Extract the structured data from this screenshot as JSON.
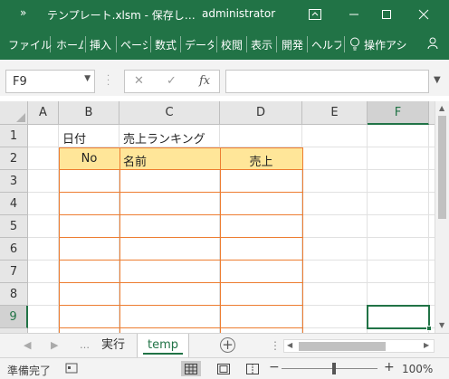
{
  "titlebar": {
    "title": "テンプレート.xlsm - 保存し…",
    "user": "administrator"
  },
  "ribbon": {
    "tabs": [
      "ファイル",
      "ホーム",
      "挿入",
      "ページ",
      "数式",
      "データ",
      "校閲",
      "表示",
      "開発",
      "ヘルプ",
      "操作アシ"
    ]
  },
  "formula_bar": {
    "name_box": "F9",
    "fx_label": "fx",
    "formula": ""
  },
  "grid": {
    "columns": [
      "A",
      "B",
      "C",
      "D",
      "E",
      "F"
    ],
    "selected_column": "F",
    "rows": [
      "1",
      "2",
      "3",
      "4",
      "5",
      "6",
      "7",
      "8",
      "9"
    ],
    "selected_row": "9",
    "cells": {
      "B1": "日付",
      "C1": "売上ランキング",
      "B2": "No",
      "C2": "名前",
      "D2": "売上"
    },
    "header_fill": "#ffe699",
    "table_border": "#ed7d31",
    "accent": "#217346"
  },
  "sheets": {
    "tabs": [
      "実行",
      "temp"
    ],
    "active": "temp"
  },
  "status": {
    "ready": "準備完了",
    "zoom": "100%"
  }
}
